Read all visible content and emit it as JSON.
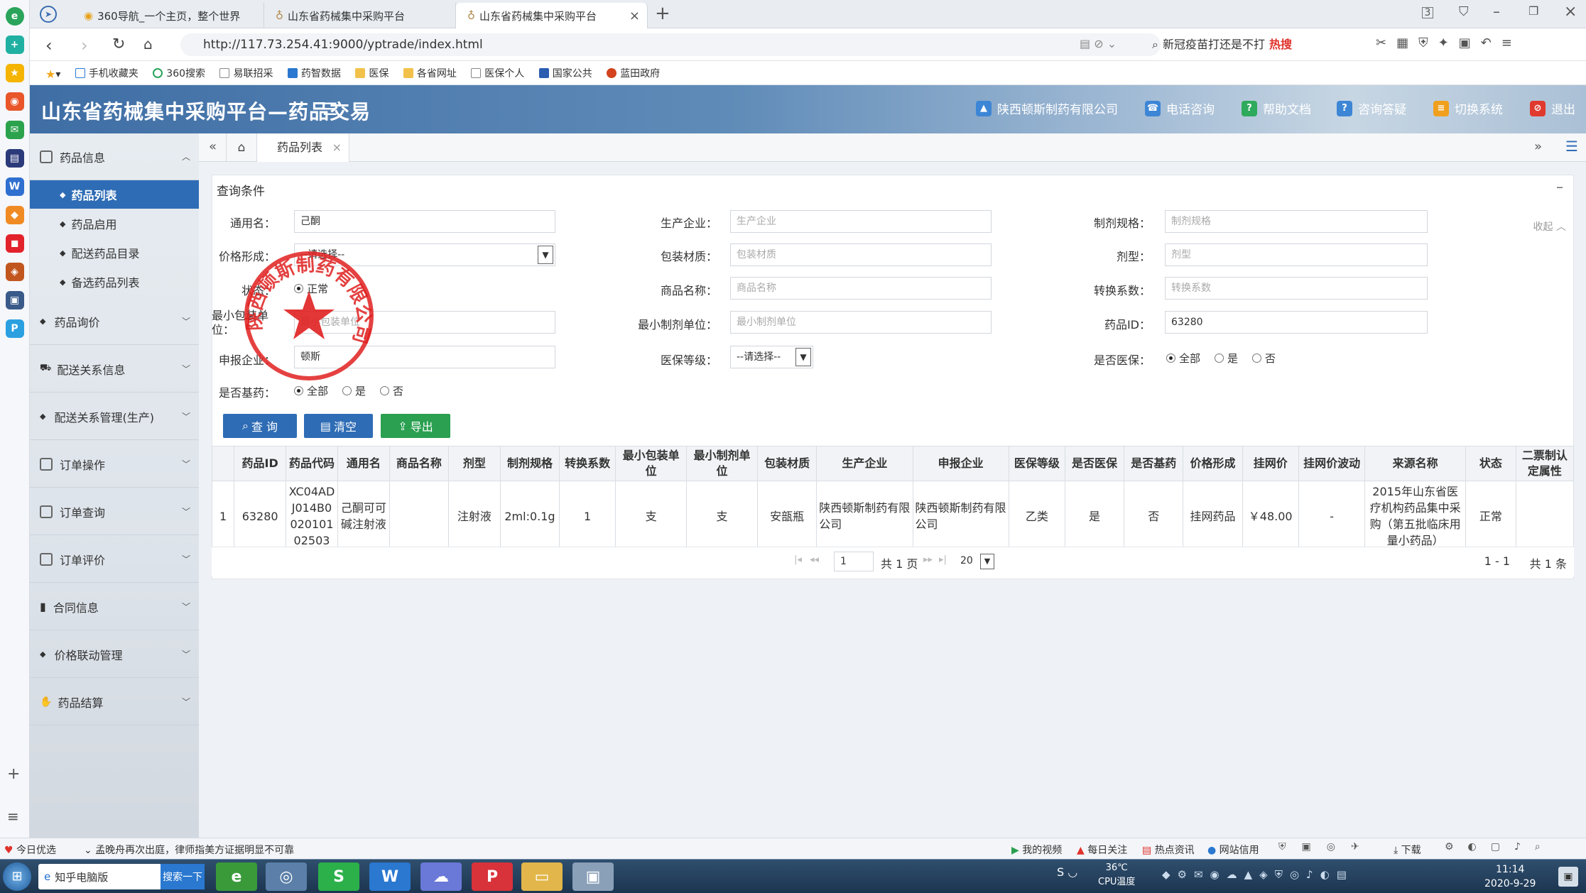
{
  "browser": {
    "tabs": [
      {
        "label": "360导航_一个主页，整个世界"
      },
      {
        "label": "山东省药械集中采购平台"
      },
      {
        "label": "山东省药械集中采购平台"
      }
    ],
    "url": "http://117.73.254.41:9000/yptrade/index.html",
    "search_hint": "新冠疫苗打还是不打",
    "hot_badge": "热搜",
    "bookmarks": [
      "手机收藏夹",
      "360搜索",
      "易联招采",
      "药智数据",
      "医保",
      "各省网址",
      "医保个人",
      "国家公共",
      "蓝田政府"
    ]
  },
  "header": {
    "title": "山东省药械集中采购平台—药品交易",
    "company": "陕西顿斯制药有限公司",
    "links": [
      "电话咨询",
      "帮助文档",
      "咨询答疑",
      "切换系统",
      "退出"
    ]
  },
  "sidebar": {
    "groups": [
      {
        "label": "药品信息"
      },
      {
        "label": "药品询价"
      },
      {
        "label": "配送关系信息"
      },
      {
        "label": "配送关系管理(生产)"
      },
      {
        "label": "订单操作"
      },
      {
        "label": "订单查询"
      },
      {
        "label": "订单评价"
      },
      {
        "label": "合同信息"
      },
      {
        "label": "价格联动管理"
      },
      {
        "label": "药品结算"
      }
    ],
    "subitems": [
      {
        "label": "药品列表"
      },
      {
        "label": "药品启用"
      },
      {
        "label": "配送药品目录"
      },
      {
        "label": "备选药品列表"
      }
    ]
  },
  "page_tab": {
    "label": "药品列表",
    "close": "×"
  },
  "query": {
    "title": "查询条件",
    "collapse": "收起",
    "fields": {
      "generic_name": {
        "label": "通用名：",
        "value": "己酮"
      },
      "manufacturer": {
        "label": "生产企业：",
        "placeholder": "生产企业"
      },
      "spec": {
        "label": "制剂规格：",
        "placeholder": "制剂规格"
      },
      "price_form": {
        "label": "价格形成：",
        "value": "--请选择--"
      },
      "packaging": {
        "label": "包装材质：",
        "placeholder": "包装材质"
      },
      "dosage_form": {
        "label": "剂型：",
        "placeholder": "剂型"
      },
      "status": {
        "label": "状态：",
        "value": "正常"
      },
      "product_name": {
        "label": "商品名称：",
        "placeholder": "商品名称"
      },
      "conversion": {
        "label": "转换系数：",
        "placeholder": "转换系数"
      },
      "min_pack": {
        "label": "最小包装单位：",
        "placeholder": "最小包装单位"
      },
      "min_unit": {
        "label": "最小制剂单位：",
        "placeholder": "最小制剂单位"
      },
      "drug_id": {
        "label": "药品ID：",
        "value": "63280"
      },
      "applicant": {
        "label": "申报企业：",
        "value": "顿斯"
      },
      "insurance_level": {
        "label": "医保等级：",
        "value": "--请选择--"
      },
      "is_insured": {
        "label": "是否医保：",
        "options": [
          "全部",
          "是",
          "否"
        ]
      },
      "is_essential": {
        "label": "是否基药：",
        "options": [
          "全部",
          "是",
          "否"
        ]
      }
    },
    "buttons": {
      "search": "查 询",
      "clear": "清空",
      "export": "导出"
    }
  },
  "table": {
    "headers": [
      "",
      "药品ID",
      "药品代码",
      "通用名",
      "商品名称",
      "剂型",
      "制剂规格",
      "转换系数",
      "最小包装单位",
      "最小制剂单位",
      "包装材质",
      "生产企业",
      "申报企业",
      "医保等级",
      "是否医保",
      "是否基药",
      "价格形成",
      "挂网价",
      "挂网价波动",
      "来源名称",
      "状态",
      "二票制认定属性"
    ],
    "rows": [
      [
        "1",
        "63280",
        "XC04ADJ014B002010102503",
        "己酮可可碱注射液",
        "",
        "注射液",
        "2ml:0.1g",
        "1",
        "支",
        "支",
        "安瓿瓶",
        "陕西顿斯制药有限公司",
        "陕西顿斯制药有限公司",
        "乙类",
        "是",
        "否",
        "挂网药品",
        "￥48.00",
        "-",
        "2015年山东省医疗机构药品集中采购（第五批临床用量小药品）",
        "正常",
        ""
      ]
    ]
  },
  "pager": {
    "page": "1",
    "total_pages": "共 1 页",
    "page_size": "20",
    "range": "1 - 1",
    "total": "共 1 条"
  },
  "stamp": {
    "text": "陕西顿斯制药有限公司"
  },
  "statusbar": {
    "left": [
      "今日优选",
      "孟晚舟再次出庭，律师指美方证据明显不可靠"
    ],
    "right": [
      "我的视频",
      "每日关注",
      "热点资讯",
      "网站信用",
      "下载"
    ]
  },
  "taskbar": {
    "zhihu": "知乎电脑版",
    "search_btn": "搜索一下",
    "temp": "36℃",
    "cpu": "CPU温度",
    "time": "11:14",
    "date": "2020-9-29"
  }
}
